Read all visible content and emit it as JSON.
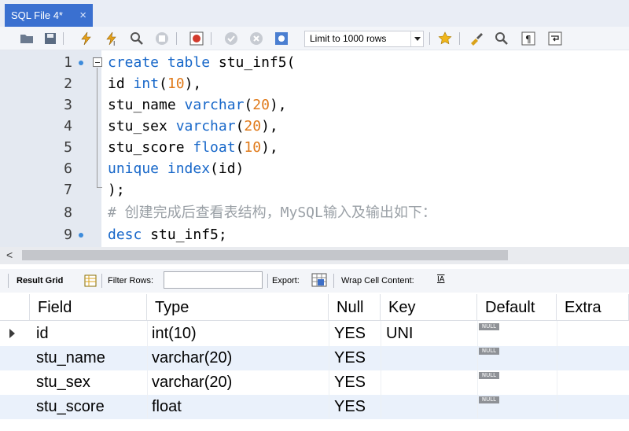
{
  "tab": {
    "title": "SQL File 4*",
    "close": "×"
  },
  "toolbar": {
    "limit_label": "Limit to 1000 rows",
    "icons": [
      "open-folder",
      "save",
      "execute",
      "execute-current",
      "explain",
      "stop",
      "toggle-output",
      "commit",
      "rollback",
      "autocommit",
      "beautify",
      "find",
      "invisible-chars",
      "word-wrap"
    ]
  },
  "editor": {
    "lines": [
      {
        "n": "1",
        "bp": true
      },
      {
        "n": "2"
      },
      {
        "n": "3"
      },
      {
        "n": "4"
      },
      {
        "n": "5"
      },
      {
        "n": "6"
      },
      {
        "n": "7"
      },
      {
        "n": "8"
      },
      {
        "n": "9",
        "bp": true
      }
    ],
    "code": {
      "l1_kw": "create table",
      "l1_rest": " stu_inf5(",
      "l2_a": "id ",
      "l2_kw": "int",
      "l2_b": "(",
      "l2_num": "10",
      "l2_c": "),",
      "l3_a": "stu_name ",
      "l3_kw": "varchar",
      "l3_b": "(",
      "l3_num": "20",
      "l3_c": "),",
      "l4_a": "stu_sex ",
      "l4_kw": "varchar",
      "l4_b": "(",
      "l4_num": "20",
      "l4_c": "),",
      "l5_a": "stu_score ",
      "l5_kw": "float",
      "l5_b": "(",
      "l5_num": "10",
      "l5_c": "),",
      "l6_kw": "unique index",
      "l6_rest": "(id)",
      "l7": ");",
      "l8": "# 创建完成后查看表结构，MySQL输入及输出如下：",
      "l9_kw": "desc",
      "l9_rest": " stu_inf5;"
    }
  },
  "result_toolbar": {
    "result_grid": "Result Grid",
    "filter_rows": "Filter Rows:",
    "export": "Export:",
    "wrap": "Wrap Cell Content:",
    "wrap_icon": "IA"
  },
  "grid": {
    "columns": [
      "Field",
      "Type",
      "Null",
      "Key",
      "Default",
      "Extra"
    ],
    "null_badge": "NULL",
    "rows": [
      {
        "field": "id",
        "type": "int(10)",
        "null": "YES",
        "key": "UNI"
      },
      {
        "field": "stu_name",
        "type": "varchar(20)",
        "null": "YES",
        "key": ""
      },
      {
        "field": "stu_sex",
        "type": "varchar(20)",
        "null": "YES",
        "key": ""
      },
      {
        "field": "stu_score",
        "type": "float",
        "null": "YES",
        "key": ""
      }
    ]
  },
  "colors": {
    "tab": "#3a70d0",
    "keyword": "#1767c9",
    "number": "#e07a1a",
    "comment": "#9aa0a6",
    "gutter": "#e4e9f1",
    "row_alt": "#eaf1fb"
  }
}
